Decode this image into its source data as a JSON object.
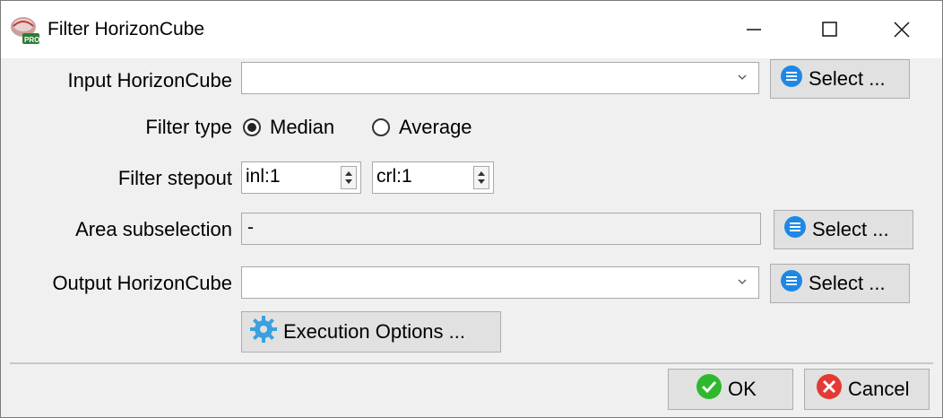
{
  "window": {
    "title": "Filter HorizonCube"
  },
  "form": {
    "input_label": "Input HorizonCube",
    "input_value": "",
    "filter_type_label": "Filter type",
    "filter_options": [
      "Median",
      "Average"
    ],
    "filter_selected": "Median",
    "stepout_label": "Filter stepout",
    "inl_value": "inl:1",
    "crl_value": "crl:1",
    "area_label": "Area subselection",
    "area_value": "-",
    "output_label": "Output HorizonCube",
    "output_value": ""
  },
  "buttons": {
    "select": "Select ...",
    "execution": "Execution Options ...",
    "ok": "OK",
    "cancel": "Cancel"
  },
  "colors": {
    "select_icon": "#1e88e5",
    "ok_icon": "#2eb82e",
    "cancel_icon": "#e53935",
    "gear_icon": "#3aa0e0"
  }
}
